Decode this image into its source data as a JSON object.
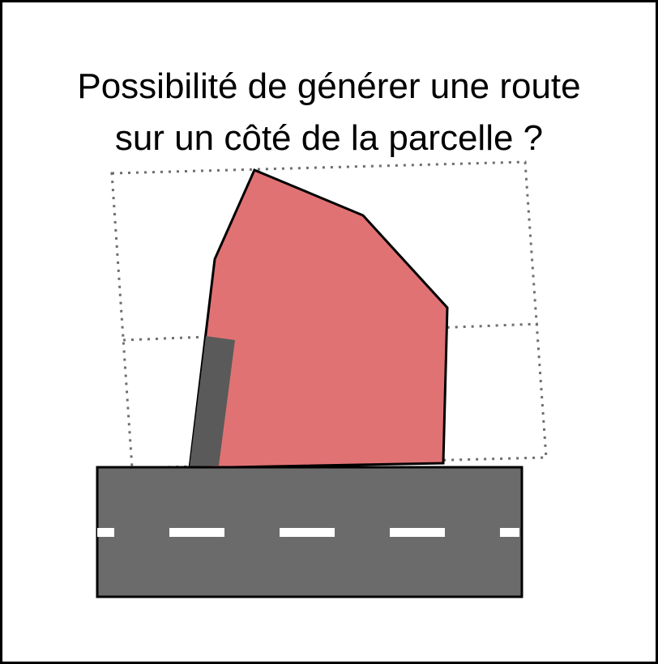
{
  "title": {
    "line1": "Possibilité de générer une route",
    "line2": "sur un côté de la parcelle ?"
  },
  "colors": {
    "parcel_fill": "#e07274",
    "parcel_stroke": "#000000",
    "road_fill": "#6b6b6b",
    "road_stroke": "#000000",
    "road_marking": "#ffffff",
    "access_strip": "#5a5a5a",
    "bounding_box_stroke": "#6e6e6e"
  }
}
